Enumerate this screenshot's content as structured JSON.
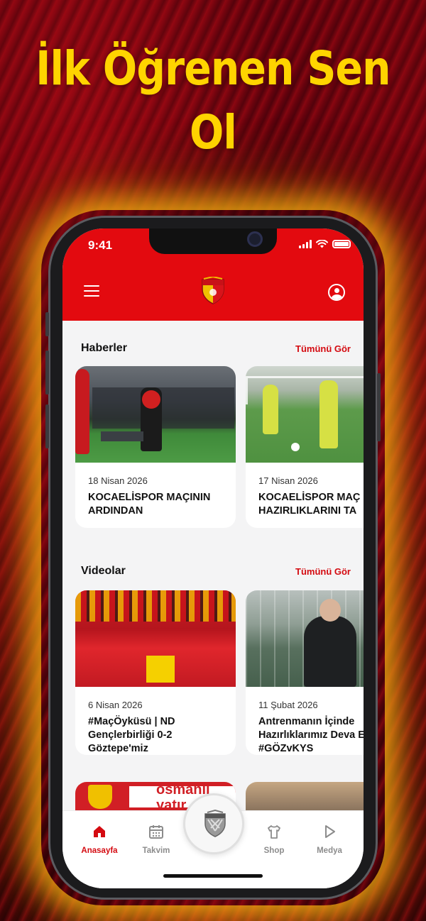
{
  "promo": {
    "headline_line1": "İlk Öğrenen Sen",
    "headline_line2": "Ol"
  },
  "status_bar": {
    "time": "9:41"
  },
  "header": {
    "menu_icon": "hamburger-menu-icon",
    "logo": "goztepe-logo",
    "profile_icon": "user-profile-icon",
    "brand_color": "#e30a0f"
  },
  "news": {
    "title": "Haberler",
    "see_all": "Tümünü Gör",
    "items": [
      {
        "date": "18 Nisan 2026",
        "title": "KOCAELİSPOR MAÇININ ARDINDAN"
      },
      {
        "date": "17 Nisan 2026",
        "title": "KOCAELİSPOR MAÇ HAZIRLIKLARINI TA"
      }
    ]
  },
  "videos": {
    "title": "Videolar",
    "see_all": "Tümünü Gör",
    "items": [
      {
        "date": "6 Nisan 2026",
        "title": "#MaçÖyküsü | ND Gençlerbirliği 0-2 Göztepe'miz"
      },
      {
        "date": "11 Şubat 2026",
        "title": "Antrenmanın İçinde Hazırlıklarımız Deva Ediyor #GÖZvKYS"
      }
    ]
  },
  "partial_row": {
    "banner_text": "osmanlı\nyatır"
  },
  "bottom_nav": {
    "items": [
      {
        "label": "Anasayfa",
        "icon": "home-icon",
        "active": true
      },
      {
        "label": "Takvim",
        "icon": "calendar-icon",
        "active": false
      },
      {
        "label": "",
        "icon": "club-crest-icon",
        "active": false
      },
      {
        "label": "Shop",
        "icon": "shirt-icon",
        "active": false
      },
      {
        "label": "Medya",
        "icon": "play-icon",
        "active": false
      }
    ]
  }
}
